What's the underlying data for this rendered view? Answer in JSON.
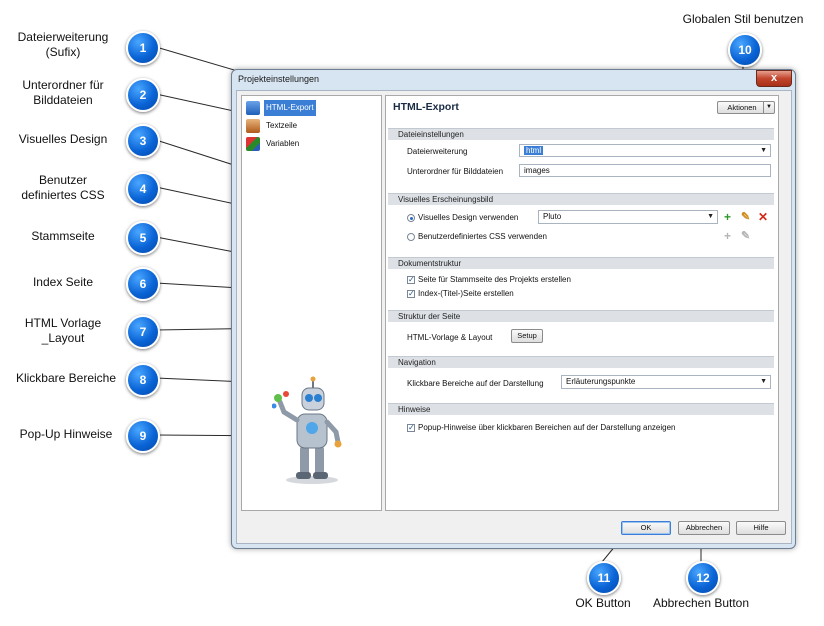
{
  "callouts": [
    {
      "num": "1",
      "label": "Dateierweiterung\n(Sufix)"
    },
    {
      "num": "2",
      "label": "Unterordner für\nBilddateien"
    },
    {
      "num": "3",
      "label": "Visuelles Design"
    },
    {
      "num": "4",
      "label": "Benutzer\ndefiniertes CSS"
    },
    {
      "num": "5",
      "label": "Stammseite"
    },
    {
      "num": "6",
      "label": "Index Seite"
    },
    {
      "num": "7",
      "label": "HTML Vorlage\n_Layout"
    },
    {
      "num": "8",
      "label": "Klickbare Bereiche"
    },
    {
      "num": "9",
      "label": "Pop-Up Hinweise"
    },
    {
      "num": "10",
      "label": "Globalen Stil benutzen"
    },
    {
      "num": "11",
      "label": "OK Button"
    },
    {
      "num": "12",
      "label": "Abbrechen Button"
    }
  ],
  "window": {
    "title": "Projekteinstellungen",
    "close_label": "x"
  },
  "nav": {
    "items": [
      {
        "label": "HTML-Export",
        "selected": true
      },
      {
        "label": "Textzeile",
        "selected": false
      },
      {
        "label": "Variablen",
        "selected": false
      }
    ]
  },
  "panel": {
    "title": "HTML-Export",
    "aktionen_label": "Aktionen",
    "sections": {
      "dateieinstellungen": "Dateieinstellungen",
      "visuelles": "Visuelles Erscheinungsbild",
      "dokument": "Dokumentstruktur",
      "struktur": "Struktur der Seite",
      "navigation": "Navigation",
      "hinweise": "Hinweise"
    },
    "dateierweiterung_label": "Dateierweiterung",
    "dateierweiterung_value": "html",
    "unterordner_label": "Unterordner für Bilddateien",
    "unterordner_value": "images",
    "design_label": "Visuelles Design verwenden",
    "design_value": "Pluto",
    "css_label": "Benutzerdefiniertes CSS verwenden",
    "stammseite_label": "Seite für Stammseite des Projekts erstellen",
    "index_label": "Index-(Titel-)Seite erstellen",
    "vorlage_label": "HTML-Vorlage & Layout",
    "setup_label": "Setup",
    "klickbar_label": "Klickbare Bereiche auf der Darstellung",
    "klickbar_value": "Erläuterungspunkte",
    "popup_label": "Popup-Hinweise über klickbaren Bereichen auf der Darstellung anzeigen"
  },
  "footer": {
    "ok": "OK",
    "cancel": "Abbrechen",
    "help": "Hilfe"
  },
  "colors": {
    "accent": "#0a64d6",
    "selection": "#3a7fd5",
    "close": "#c2452d"
  }
}
